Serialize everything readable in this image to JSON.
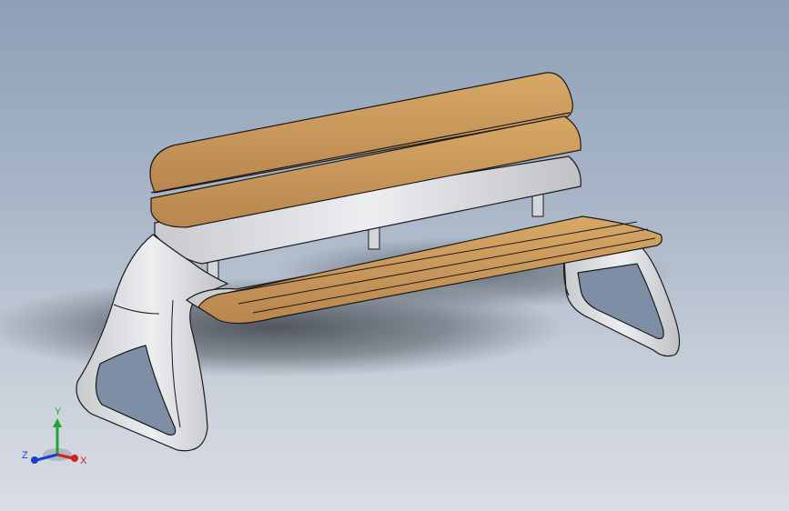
{
  "viewport": {
    "background_top": "#8e9fb6",
    "background_bottom": "#d9dde4"
  },
  "model": {
    "wood_color": "#c9965a",
    "frame_color": "#d7d8dc",
    "edge_color": "#1a1a1a"
  },
  "triad": {
    "x_label": "X",
    "y_label": "Y",
    "z_label": "Z",
    "x_color": "#d21f1f",
    "y_color": "#1fa82f",
    "z_color": "#1f3ad2"
  }
}
